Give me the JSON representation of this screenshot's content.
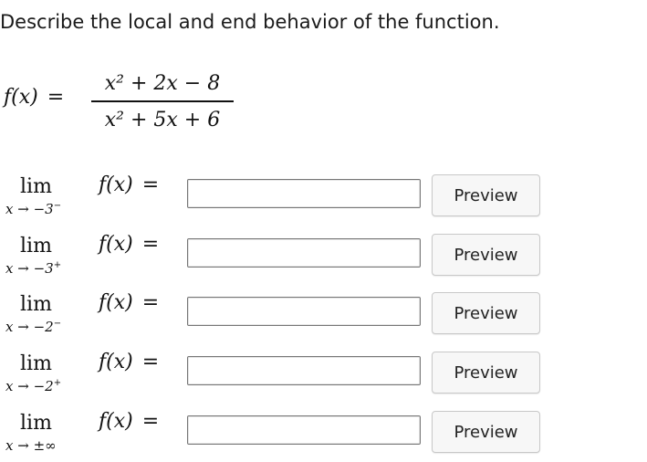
{
  "prompt": "Describe the local and end behavior of the function.",
  "function": {
    "lhs": "f(x)",
    "equals": "=",
    "numerator": "x² + 2x − 8",
    "denominator": "x² + 5x + 6"
  },
  "limits": [
    {
      "lim": "lim",
      "approach": "x → −3",
      "side": "−",
      "expr": "f(x)",
      "equals": "=",
      "answer": "",
      "button": "Preview"
    },
    {
      "lim": "lim",
      "approach": "x → −3",
      "side": "+",
      "expr": "f(x)",
      "equals": "=",
      "answer": "",
      "button": "Preview"
    },
    {
      "lim": "lim",
      "approach": "x → −2",
      "side": "−",
      "expr": "f(x)",
      "equals": "=",
      "answer": "",
      "button": "Preview"
    },
    {
      "lim": "lim",
      "approach": "x → −2",
      "side": "+",
      "expr": "f(x)",
      "equals": "=",
      "answer": "",
      "button": "Preview"
    },
    {
      "lim": "lim",
      "approach": "x → ±∞",
      "side": "",
      "expr": "f(x)",
      "equals": "=",
      "answer": "",
      "button": "Preview"
    }
  ]
}
